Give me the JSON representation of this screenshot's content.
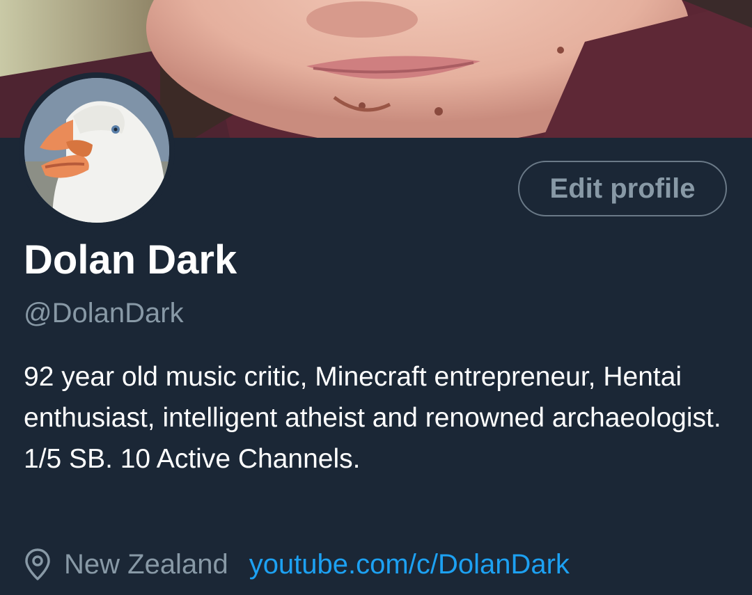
{
  "profile": {
    "display_name": "Dolan Dark",
    "handle": "@DolanDark",
    "bio": "92 year old music critic, Minecraft entrepreneur, Hentai enthusiast, intelligent atheist and renowned archaeologist. 1/5 SB. 10 Active Channels.",
    "location": "New Zealand",
    "website": "youtube.com/c/DolanDark"
  },
  "actions": {
    "edit_profile_label": "Edit profile"
  },
  "icons": {
    "location": "location-pin-icon"
  },
  "colors": {
    "background": "#1b2736",
    "primary_text": "#ffffff",
    "secondary_text": "#8899a6",
    "link": "#1da1f2",
    "button_border": "#6b7a88"
  }
}
